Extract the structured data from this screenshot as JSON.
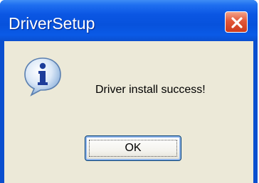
{
  "window": {
    "title": "DriverSetup",
    "close_icon": "close-icon"
  },
  "dialog": {
    "icon": "info-icon",
    "message": "Driver install success!",
    "ok_label": "OK"
  },
  "colors": {
    "titlebar": "#0752dc",
    "client_background": "#ece9d8",
    "close_button": "#e2583a"
  }
}
